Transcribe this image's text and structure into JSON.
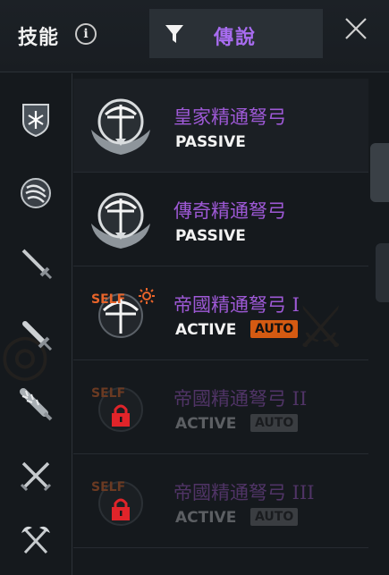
{
  "header": {
    "title": "技能",
    "info_icon_glyph": "i",
    "filter": {
      "icon": "funnel-icon",
      "label": "傳說"
    },
    "close_icon": "close-icon"
  },
  "colors": {
    "legendary": "#9e59d6",
    "auto_badge": "#d45a12",
    "self_tag": "#e8642a",
    "lock": "#e0242a"
  },
  "sidebar": {
    "categories": [
      {
        "icon": "shield-emblem-icon",
        "selected": true
      },
      {
        "icon": "round-shield-icon",
        "selected": false
      },
      {
        "icon": "sword-icon",
        "selected": false
      },
      {
        "icon": "dagger-icon",
        "selected": false
      },
      {
        "icon": "spiked-club-icon",
        "selected": false
      },
      {
        "icon": "crossed-swords-icon",
        "selected": false
      },
      {
        "icon": "crossed-axes-icon",
        "selected": false
      }
    ]
  },
  "skills": [
    {
      "name": "皇家精通弩弓",
      "type": "PASSIVE",
      "locked": false,
      "icon": "crossbow-winged-emblem-icon"
    },
    {
      "name": "傳奇精通弩弓",
      "type": "PASSIVE",
      "locked": false,
      "icon": "crossbow-winged-emblem-icon"
    },
    {
      "name": "帝國精通弩弓 I",
      "type": "ACTIVE",
      "badge": "AUTO",
      "tag": "SELF",
      "locked": false,
      "icon": "crossbow-icon"
    },
    {
      "name": "帝國精通弩弓 II",
      "type": "ACTIVE",
      "badge": "AUTO",
      "tag": "SELF",
      "locked": true,
      "icon": "lock-icon"
    },
    {
      "name": "帝國精通弩弓 III",
      "type": "ACTIVE",
      "badge": "AUTO",
      "tag": "SELF",
      "locked": true,
      "icon": "lock-icon"
    }
  ]
}
